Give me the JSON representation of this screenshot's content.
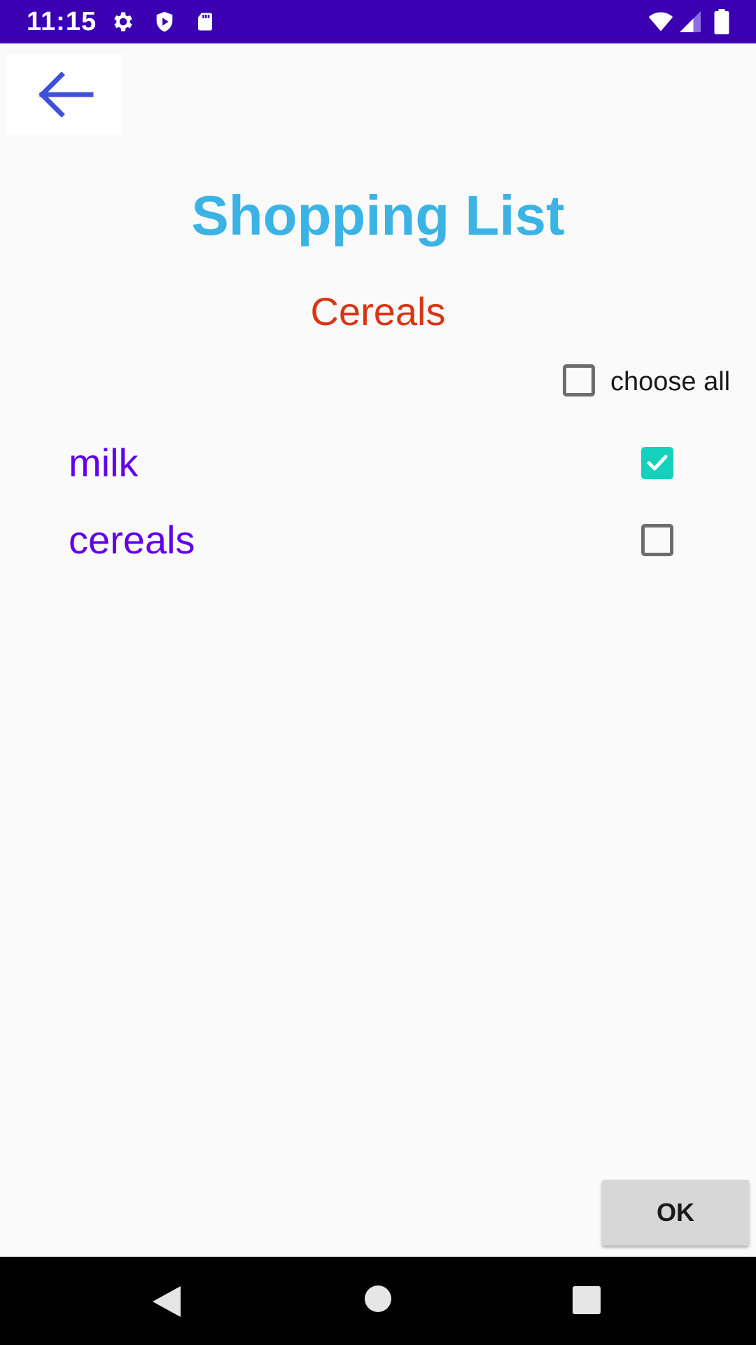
{
  "status_bar": {
    "time": "11:15",
    "icons_left": [
      "settings-icon",
      "shield-icon",
      "sd-card-icon"
    ],
    "icons_right": [
      "wifi-icon",
      "signal-icon",
      "battery-icon"
    ],
    "background": "#3a00b2"
  },
  "header": {
    "back_icon": "arrow-left-icon",
    "title": "Shopping List",
    "subtitle": "Cereals"
  },
  "choose_all": {
    "label": "choose all",
    "checked": false
  },
  "items": [
    {
      "label": "milk",
      "checked": true
    },
    {
      "label": "cereals",
      "checked": false
    }
  ],
  "footer": {
    "ok_label": "OK"
  },
  "nav_bar": {
    "icons": [
      "back-triangle-icon",
      "home-circle-icon",
      "recents-square-icon"
    ]
  },
  "colors": {
    "title": "#3bb3e5",
    "subtitle": "#d83515",
    "item_text": "#6200ea",
    "checkbox_checked": "#12d2bd",
    "back_arrow": "#3f51d8"
  }
}
